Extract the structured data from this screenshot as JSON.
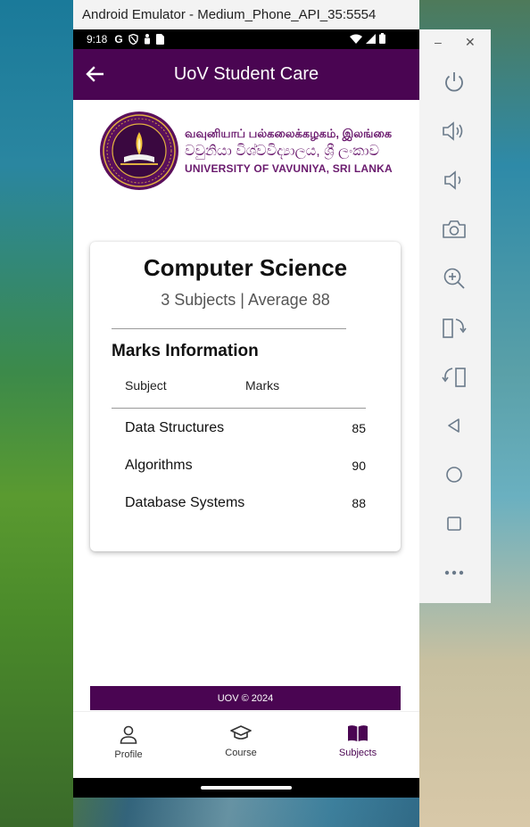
{
  "window": {
    "title": "Android Emulator - Medium_Phone_API_35:5554"
  },
  "statusbar": {
    "time": "9:18",
    "google_letter": "G"
  },
  "appbar": {
    "title": "UoV Student Care"
  },
  "logo": {
    "tamil": "வவுனியாப் பல்கலைக்கழகம், இலங்கை",
    "sinhala": "වවුනියා විශ්වවිද්‍යාලය, ශ්‍රී ලංකාව",
    "english": "UNIVERSITY OF VAVUNIYA, SRI LANKA"
  },
  "card": {
    "course_name": "Computer Science",
    "summary": "3 Subjects | Average  88",
    "marks_heading": "Marks Information",
    "col_subject": "Subject",
    "col_marks": "Marks",
    "rows": [
      {
        "subject": "Data Structures",
        "mark": "85"
      },
      {
        "subject": "Algorithms",
        "mark": "90"
      },
      {
        "subject": "Database Systems",
        "mark": "88"
      }
    ]
  },
  "footer": {
    "text": "UOV © 2024"
  },
  "nav": {
    "items": [
      {
        "label": "Profile",
        "icon": "person-icon",
        "active": false
      },
      {
        "label": "Course",
        "icon": "graduation-cap-icon",
        "active": false
      },
      {
        "label": "Subjects",
        "icon": "book-icon",
        "active": true
      }
    ],
    "active_color": "#4a0552",
    "inactive_color": "#333333"
  },
  "emulator_panel": {
    "buttons": [
      "power-icon",
      "volume-up-icon",
      "volume-down-icon",
      "camera-icon",
      "zoom-in-icon",
      "rotate-left-icon",
      "rotate-right-icon",
      "back-icon",
      "home-icon",
      "overview-icon",
      "more-icon"
    ]
  },
  "colors": {
    "primary": "#4a0552"
  }
}
